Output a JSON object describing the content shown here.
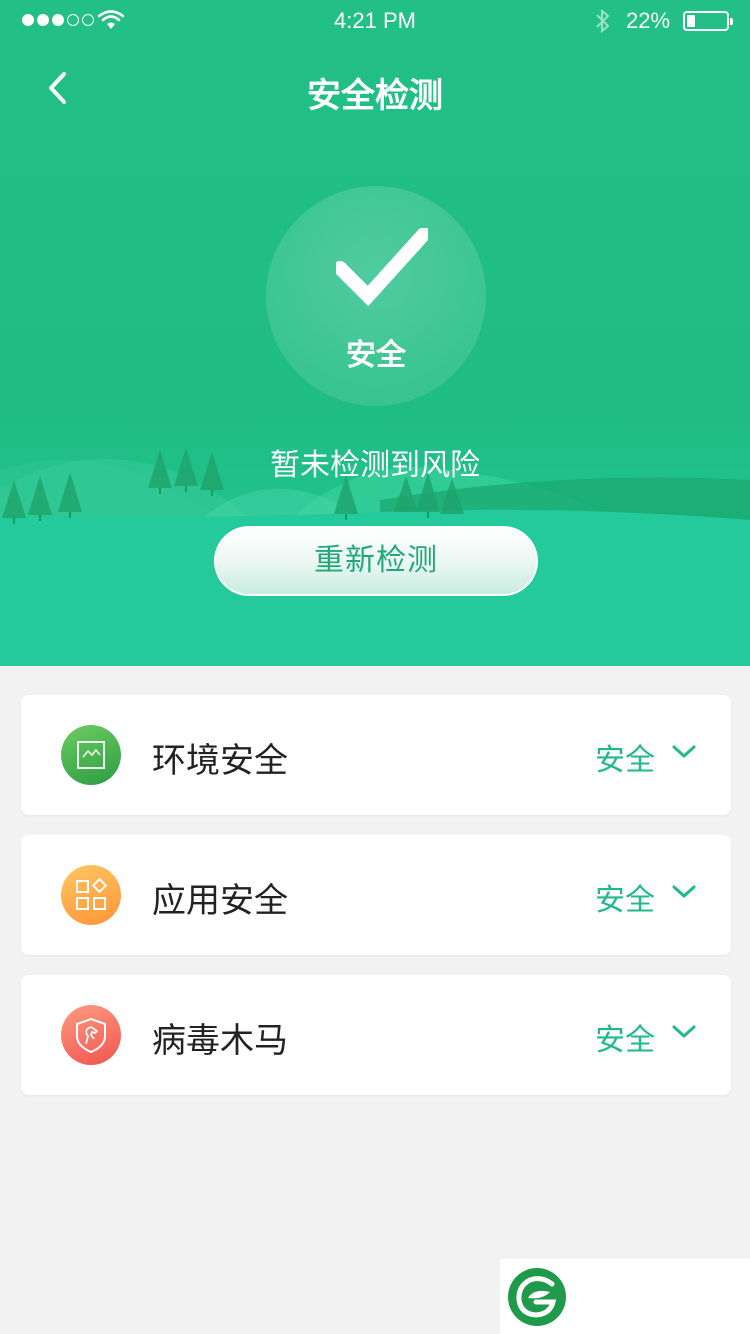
{
  "statusbar": {
    "time": "4:21 PM",
    "battery_pct": "22%",
    "battery_level": 0.22,
    "signal_bars_filled": 3,
    "signal_bars_total": 5
  },
  "nav": {
    "title": "安全检测",
    "back_icon": "chevron-left-icon"
  },
  "summary": {
    "circle_label": "安全",
    "risk_text": "暂未检测到风险",
    "rescan_label": "重新检测"
  },
  "cards": [
    {
      "title": "环境安全",
      "status": "安全",
      "icon": "environment-icon",
      "icon_colors": [
        "#5ec25e",
        "#2f9b41"
      ]
    },
    {
      "title": "应用安全",
      "status": "安全",
      "icon": "apps-icon",
      "icon_colors": [
        "#ffc25a",
        "#ff9a3c"
      ]
    },
    {
      "title": "病毒木马",
      "status": "安全",
      "icon": "shield-horse-icon",
      "icon_colors": [
        "#ff8f7a",
        "#f25a52"
      ]
    }
  ],
  "colors": {
    "brand_green": "#1fbc83",
    "status_green": "#1fb98a",
    "background": "#f2f2f2"
  }
}
